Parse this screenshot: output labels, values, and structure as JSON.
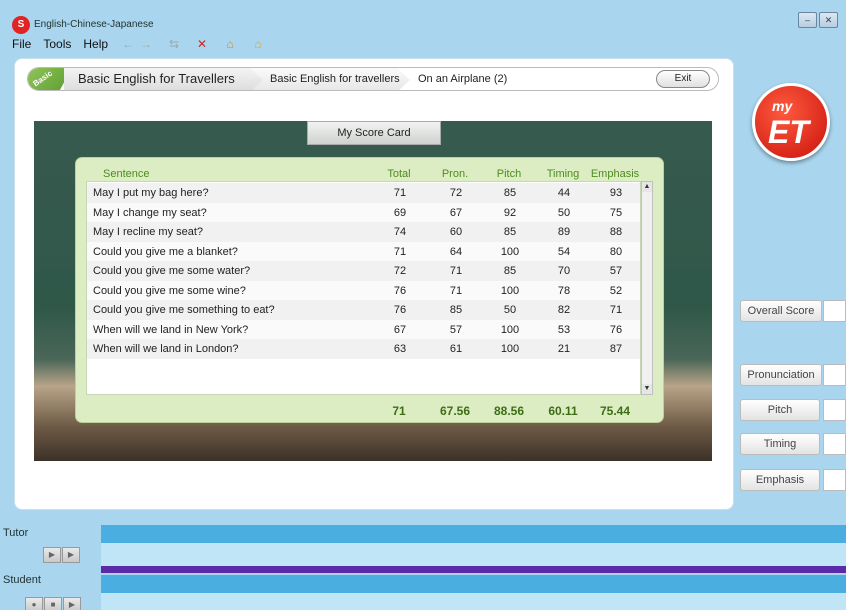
{
  "app": {
    "title": "English-Chinese-Japanese",
    "logo_text": "S"
  },
  "menu": {
    "items": [
      "File",
      "Tools",
      "Help"
    ]
  },
  "toolbar": {
    "icons": [
      "back-icon",
      "forward-icon",
      "refresh-icon",
      "stop-icon",
      "home-icon",
      "home-alt-icon"
    ],
    "glyphs": [
      "←",
      "→",
      "⇆",
      "✕",
      "⌂",
      "⌂"
    ]
  },
  "window_controls": {
    "minimize": "–",
    "close": "✕"
  },
  "breadcrumb": {
    "level_tag": "Basic",
    "segments": [
      "Basic English for Travellers",
      "Basic English for travellers",
      "On an Airplane (2)"
    ]
  },
  "exit_label": "Exit",
  "scorecard": {
    "tab_label": "My Score Card",
    "columns": [
      "Sentence",
      "Total",
      "Pron.",
      "Pitch",
      "Timing",
      "Emphasis"
    ],
    "rows": [
      [
        "May I put my bag here?",
        "71",
        "72",
        "85",
        "44",
        "93"
      ],
      [
        "May I change my seat?",
        "69",
        "67",
        "92",
        "50",
        "75"
      ],
      [
        "May I recline my seat?",
        "74",
        "60",
        "85",
        "89",
        "88"
      ],
      [
        "Could you give me a blanket?",
        "71",
        "64",
        "100",
        "54",
        "80"
      ],
      [
        "Could you give me some water?",
        "72",
        "71",
        "85",
        "70",
        "57"
      ],
      [
        "Could you give me some wine?",
        "76",
        "71",
        "100",
        "78",
        "52"
      ],
      [
        "Could you give me something to eat?",
        "76",
        "85",
        "50",
        "82",
        "71"
      ],
      [
        "When will we land in New York?",
        "67",
        "57",
        "100",
        "53",
        "76"
      ],
      [
        "When will we land in London?",
        "63",
        "61",
        "100",
        "21",
        "87"
      ]
    ],
    "totals": [
      "71",
      "67.56",
      "88.56",
      "60.11",
      "75.44"
    ]
  },
  "logo": {
    "top": "my",
    "bottom": "ET"
  },
  "side_buttons": [
    "Overall Score",
    "Pronunciation",
    "Pitch",
    "Timing",
    "Emphasis"
  ],
  "bottom": {
    "tutor_label": "Tutor",
    "student_label": "Student",
    "tutor_controls": [
      "▶",
      "▶"
    ],
    "student_controls": [
      "●",
      "■",
      "▶"
    ]
  },
  "colors": {
    "background": "#a9d6ee",
    "header_green": "#4d8c1d",
    "totals_green": "#3e6e14",
    "track_blue": "#4aaee0",
    "track_purple": "#5a2aa8"
  }
}
